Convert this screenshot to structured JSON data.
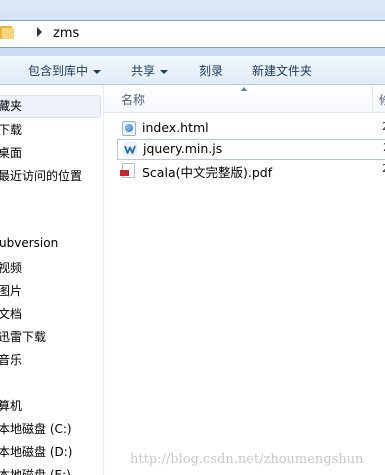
{
  "address_bar": {
    "folder_icon": "folder-icon",
    "chevron_icon": "chevron-right-icon",
    "path": "zms"
  },
  "toolbar": {
    "include_in_library": "包含到库中",
    "share": "共享",
    "burn": "刻录",
    "new_folder": "新建文件夹"
  },
  "nav": {
    "items": [
      "藏夹",
      "下载",
      "桌面",
      "最近访问的位置",
      "ubversion",
      "视频",
      "图片",
      "文档",
      "迅雷下载",
      "音乐",
      "算机",
      "本地磁盘 (C:)",
      "本地磁盘 (D:)",
      "本地磁盘 (E:)"
    ]
  },
  "file_list": {
    "column_name": "名称",
    "column_date_truncated": "修",
    "files": [
      {
        "name": "index.html",
        "icon": "html-file-icon",
        "date_truncated": "2"
      },
      {
        "name": "jquery.min.js",
        "icon": "js-file-icon",
        "date_truncated": "2"
      },
      {
        "name": "Scala(中文完整版).pdf",
        "icon": "pdf-file-icon",
        "date_truncated": "2"
      }
    ]
  },
  "watermark": "http://blog.csdn.net/zhoumengshun"
}
